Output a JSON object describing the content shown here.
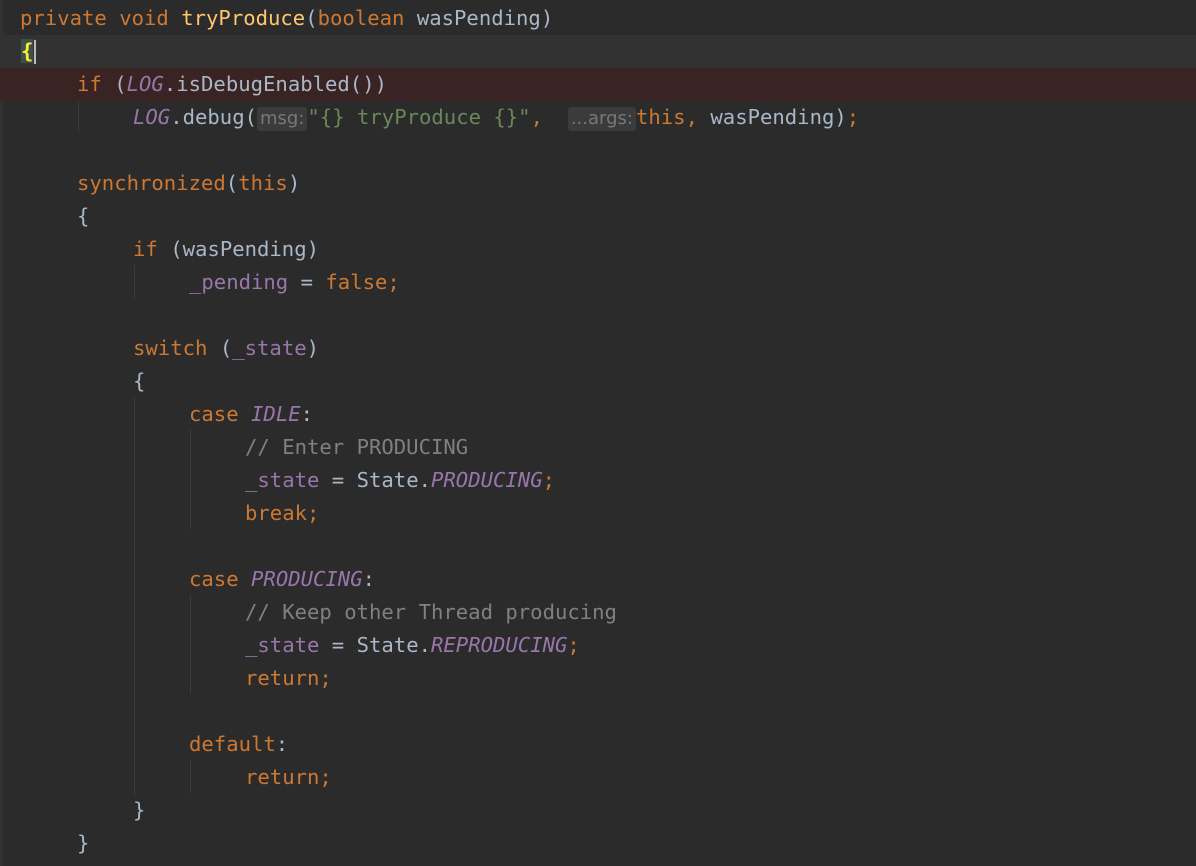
{
  "editor": {
    "line1": {
      "kw_private": "private",
      "kw_void": "void",
      "method": "tryProduce",
      "open": "(",
      "kw_boolean": "boolean",
      "param": "wasPending",
      "close": ")"
    },
    "line2": {
      "brace": "{"
    },
    "line3": {
      "kw_if": "if",
      "open": "(",
      "log": "LOG",
      "call": ".isDebugEnabled())"
    },
    "line4": {
      "log": "LOG",
      "call": ".debug(",
      "hint_msg": "msg:",
      "string": "\"{} tryProduce {}\"",
      "comma": ",",
      "hint_args": "...args:",
      "kw_this": "this",
      "comma2": ",",
      "arg": "wasPending)",
      "semi": ";"
    },
    "line6": {
      "kw_synchronized": "synchronized",
      "open": "(",
      "kw_this": "this",
      "close": ")"
    },
    "line7": {
      "brace": "{"
    },
    "line8": {
      "kw_if": "if",
      "cond": "(wasPending)"
    },
    "line9": {
      "field": "_pending",
      "eq": " = ",
      "kw_false": "false",
      "semi": ";"
    },
    "line11": {
      "kw_switch": "switch",
      "open": "(",
      "field": "_state",
      "close": ")"
    },
    "line12": {
      "brace": "{"
    },
    "line13": {
      "kw_case": "case",
      "const": "IDLE",
      "colon": ":"
    },
    "line14": {
      "comment": "// Enter PRODUCING"
    },
    "line15": {
      "field": "_state",
      "eq": " = State.",
      "const": "PRODUCING",
      "semi": ";"
    },
    "line16": {
      "kw_break": "break",
      "semi": ";"
    },
    "line18": {
      "kw_case": "case",
      "const": "PRODUCING",
      "colon": ":"
    },
    "line19": {
      "comment": "// Keep other Thread producing"
    },
    "line20": {
      "field": "_state",
      "eq": " = State.",
      "const": "REPRODUCING",
      "semi": ";"
    },
    "line21": {
      "kw_return": "return",
      "semi": ";"
    },
    "line23": {
      "kw_default": "default",
      "colon": ":"
    },
    "line24": {
      "kw_return": "return",
      "semi": ";"
    },
    "line25": {
      "brace": "}"
    },
    "line26": {
      "brace": "}"
    }
  },
  "colors": {
    "background": "#2b2b2b",
    "keyword": "#cc7832",
    "method": "#ffc66d",
    "string": "#6a8759",
    "field": "#9876aa",
    "comment": "#808080",
    "text": "#a9b7c6",
    "breakpoint_line": "#3a2323"
  }
}
